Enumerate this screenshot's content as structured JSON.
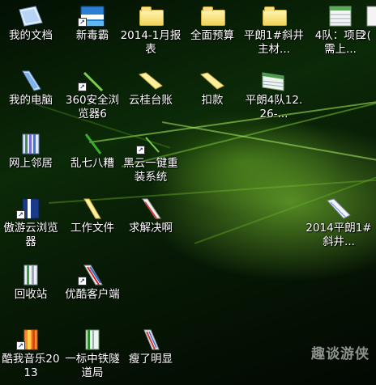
{
  "desktop": {
    "icons": [
      {
        "label": "我的文档"
      },
      {
        "label": "新毒霸"
      },
      {
        "label": "2014-1月报表"
      },
      {
        "label": "全面预算"
      },
      {
        "label": "平朗1#斜井主材..."
      },
      {
        "label": "4队：项目需上..."
      },
      {
        "label": "2("
      },
      {
        "label": "我的电脑"
      },
      {
        "label": "360安全浏览器6"
      },
      {
        "label": "云桂台账"
      },
      {
        "label": "扣款"
      },
      {
        "label": "平朗4队12.26-..."
      },
      {
        "label": "网上邻居"
      },
      {
        "label": "乱七八糟"
      },
      {
        "label": "黑云一键重装系统"
      },
      {
        "label": "傲游云浏览器"
      },
      {
        "label": "工作文件"
      },
      {
        "label": "求解决啊"
      },
      {
        "label": "2014平朗1#斜井..."
      },
      {
        "label": "回收站"
      },
      {
        "label": "优酷客户端"
      },
      {
        "label": "酷我音乐2013"
      },
      {
        "label": "一标中铁隧道局"
      },
      {
        "label": "瘦了明显"
      }
    ]
  },
  "watermark": {
    "text": "趣谈游侠"
  }
}
